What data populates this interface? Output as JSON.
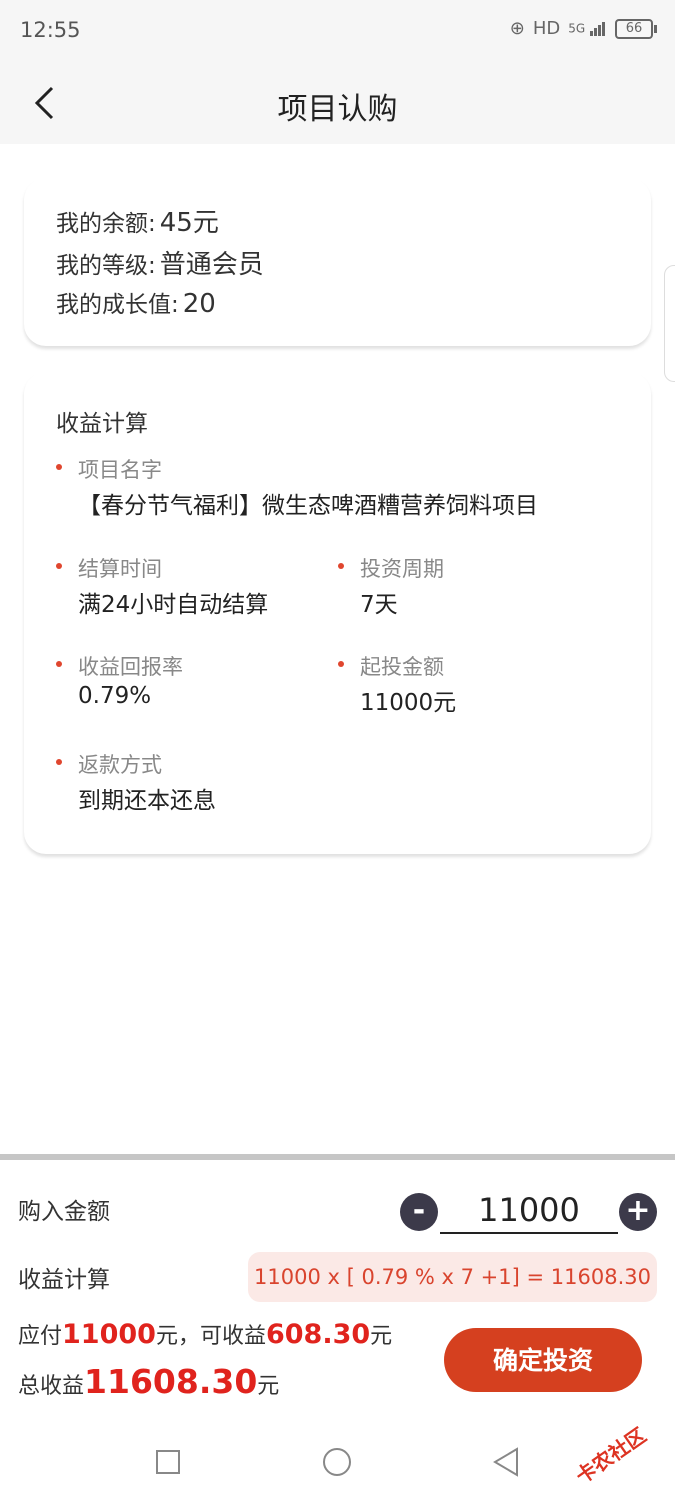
{
  "status": {
    "time": "12:55",
    "network": "HD",
    "signal": "5G",
    "battery": "66"
  },
  "header": {
    "title": "项目认购"
  },
  "account": {
    "balance_label": "我的余额:",
    "balance_value": "45元",
    "level_label": "我的等级:",
    "level_value": "普通会员",
    "growth_label": "我的成长值:",
    "growth_value": "20"
  },
  "calc": {
    "section_title": "收益计算",
    "project_name_label": "项目名字",
    "project_name": "【春分节气福利】微生态啤酒糟营养饲料项目",
    "settle_label": "结算时间",
    "settle_value": "满24小时自动结算",
    "period_label": "投资周期",
    "period_value": "7天",
    "rate_label": "收益回报率",
    "rate_value": "0.79%",
    "min_label": "起投金额",
    "min_value": "11000元",
    "repay_label": "返款方式",
    "repay_value": "到期还本还息"
  },
  "purchase": {
    "amount_label": "购入金额",
    "minus": "-",
    "plus": "+",
    "amount_value": "11000",
    "calc_label": "收益计算",
    "formula": "11000 x [ 0.79 % x 7 +1] = 11608.30",
    "pay_prefix": "应付",
    "pay_amount": "11000",
    "pay_mid": "元，可收益",
    "profit_amount": "608.30",
    "pay_suffix": "元",
    "total_prefix": "总收益",
    "total_amount": "11608.30",
    "total_suffix": "元",
    "confirm_label": "确定投资"
  },
  "watermark": "卡农社区",
  "colors": {
    "accent": "#d5401f",
    "highlight": "#e0231d",
    "formula_bg": "#fbe9e6",
    "bullet": "#e0462e"
  }
}
